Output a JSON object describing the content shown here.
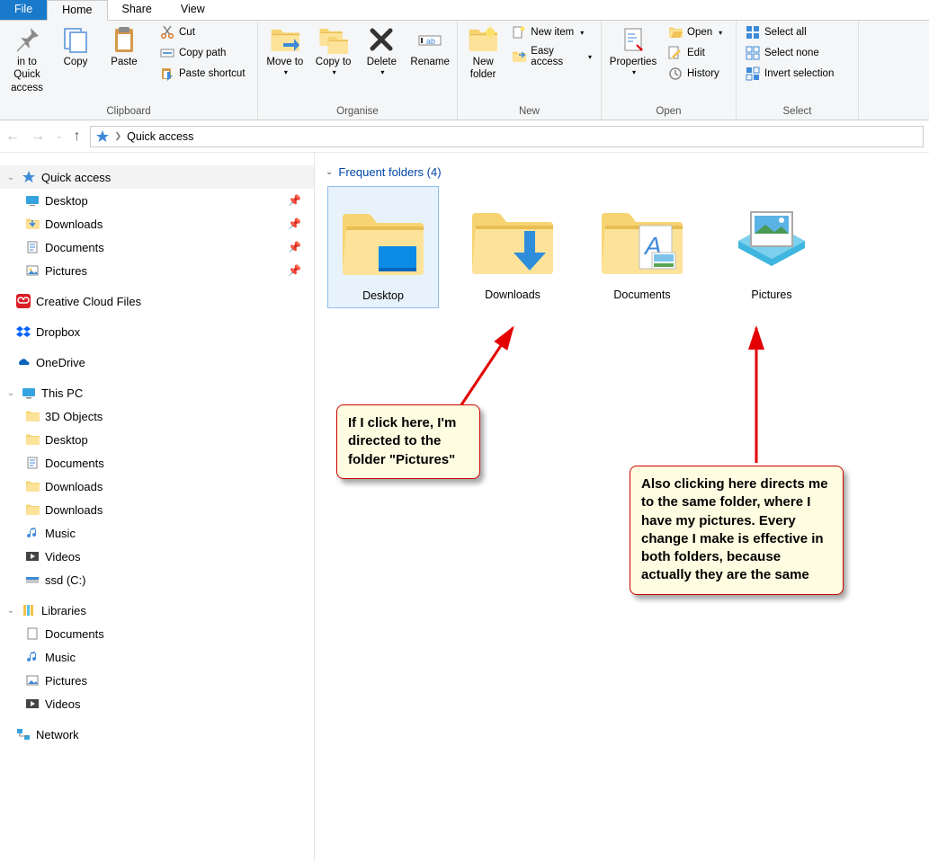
{
  "tabs": {
    "file": "File",
    "home": "Home",
    "share": "Share",
    "view": "View"
  },
  "ribbon": {
    "clipboard": {
      "label": "Clipboard",
      "pin": "in to Quick access",
      "copy": "Copy",
      "paste": "Paste",
      "cut": "Cut",
      "copypath": "Copy path",
      "pasteshortcut": "Paste shortcut"
    },
    "organise": {
      "label": "Organise",
      "moveto": "Move to",
      "copyto": "Copy to",
      "delete": "Delete",
      "rename": "Rename"
    },
    "new": {
      "label": "New",
      "newfolder": "New folder",
      "newitem": "New item",
      "easyaccess": "Easy access"
    },
    "open": {
      "label": "Open",
      "properties": "Properties",
      "open": "Open",
      "edit": "Edit",
      "history": "History"
    },
    "select": {
      "label": "Select",
      "selectall": "Select all",
      "selectnone": "Select none",
      "invert": "Invert selection"
    }
  },
  "nav": {
    "current": "Quick access"
  },
  "sidebar": {
    "quickaccess": "Quick access",
    "pinned": [
      {
        "label": "Desktop"
      },
      {
        "label": "Downloads"
      },
      {
        "label": "Documents"
      },
      {
        "label": "Pictures"
      }
    ],
    "ccf": "Creative Cloud Files",
    "dropbox": "Dropbox",
    "onedrive": "OneDrive",
    "thispc": "This PC",
    "pcitems": [
      {
        "label": "3D Objects"
      },
      {
        "label": "Desktop"
      },
      {
        "label": "Documents"
      },
      {
        "label": "Downloads"
      },
      {
        "label": "Downloads"
      },
      {
        "label": "Music"
      },
      {
        "label": "Videos"
      },
      {
        "label": "ssd (C:)"
      }
    ],
    "libraries": "Libraries",
    "libitems": [
      {
        "label": "Documents"
      },
      {
        "label": "Music"
      },
      {
        "label": "Pictures"
      },
      {
        "label": "Videos"
      }
    ],
    "network": "Network"
  },
  "content": {
    "section": "Frequent folders (4)",
    "folders": [
      {
        "label": "Desktop"
      },
      {
        "label": "Downloads"
      },
      {
        "label": "Documents"
      },
      {
        "label": "Pictures"
      }
    ]
  },
  "callouts": {
    "left": "If I click here, I'm directed to the folder \"Pictures\"",
    "right": "Also clicking here directs me to the same folder, where I have my pictures. Every change I make is effective in both folders, because actually they are the same"
  }
}
